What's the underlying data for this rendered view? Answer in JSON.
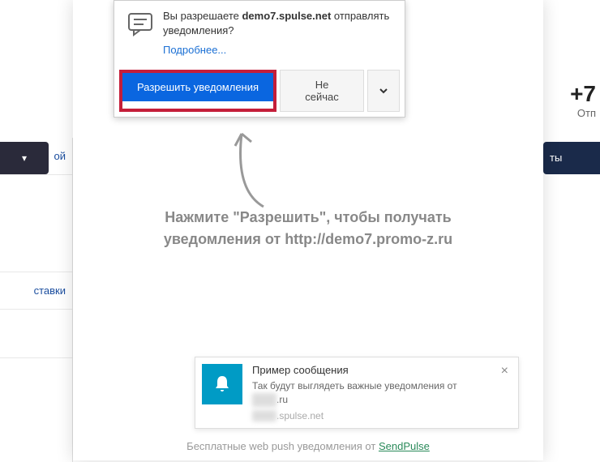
{
  "leftNav": {
    "dropdown_icon": "▾",
    "item1": "ой",
    "item2": "ставки"
  },
  "rightSide": {
    "phone": "+7",
    "phone_label": "Отп",
    "right_btn": "ты"
  },
  "permission": {
    "question_prefix": "Вы разрешаете ",
    "domain": "demo7.spulse.net",
    "question_suffix": " отправлять",
    "question_line2": "уведомления?",
    "more_link": "Подробнее...",
    "allow_btn": "Разрешить уведомления",
    "notnow_btn": "Не сейчас"
  },
  "instruction": {
    "line1": "Нажмите \"Разрешить\", чтобы получать",
    "line2": "уведомления от http://demo7.promo-z.ru"
  },
  "sample": {
    "title": "Пример сообщения",
    "desc": "Так будут выглядеть важные уведомления от",
    "desc_domain": ".ru",
    "source": ".spulse.net",
    "close": "×"
  },
  "footer": {
    "text": "Бесплатные web push уведомления от ",
    "link": "SendPulse"
  }
}
